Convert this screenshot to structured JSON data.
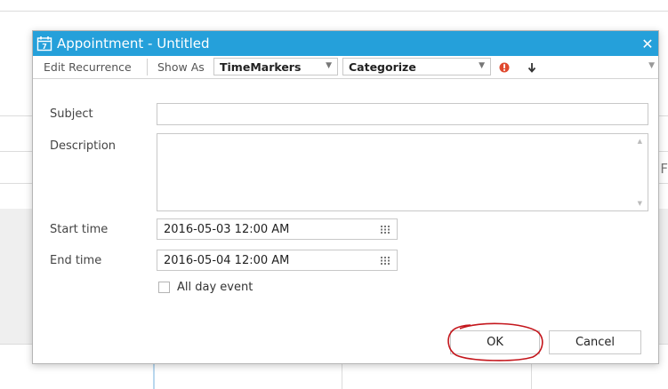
{
  "dialog": {
    "title": "Appointment - Untitled",
    "close_glyph": "✕",
    "titlebar_color": "#25a0da"
  },
  "toolbar": {
    "edit_recurrence": "Edit Recurrence",
    "show_as_label": "Show As",
    "show_as_value": "TimeMarkers",
    "categorize_value": "Categorize",
    "important_icon": "exclamation-icon",
    "low_importance_icon": "down-arrow-icon"
  },
  "form": {
    "subject_label": "Subject",
    "subject_value": "",
    "description_label": "Description",
    "description_value": "",
    "start_label": "Start time",
    "start_value": "2016-05-03 12:00 AM",
    "end_label": "End time",
    "end_value": "2016-05-04 12:00 AM",
    "all_day_label": "All day event",
    "all_day_checked": false
  },
  "buttons": {
    "ok": "OK",
    "cancel": "Cancel"
  },
  "background": {
    "partial_letter": "F"
  }
}
